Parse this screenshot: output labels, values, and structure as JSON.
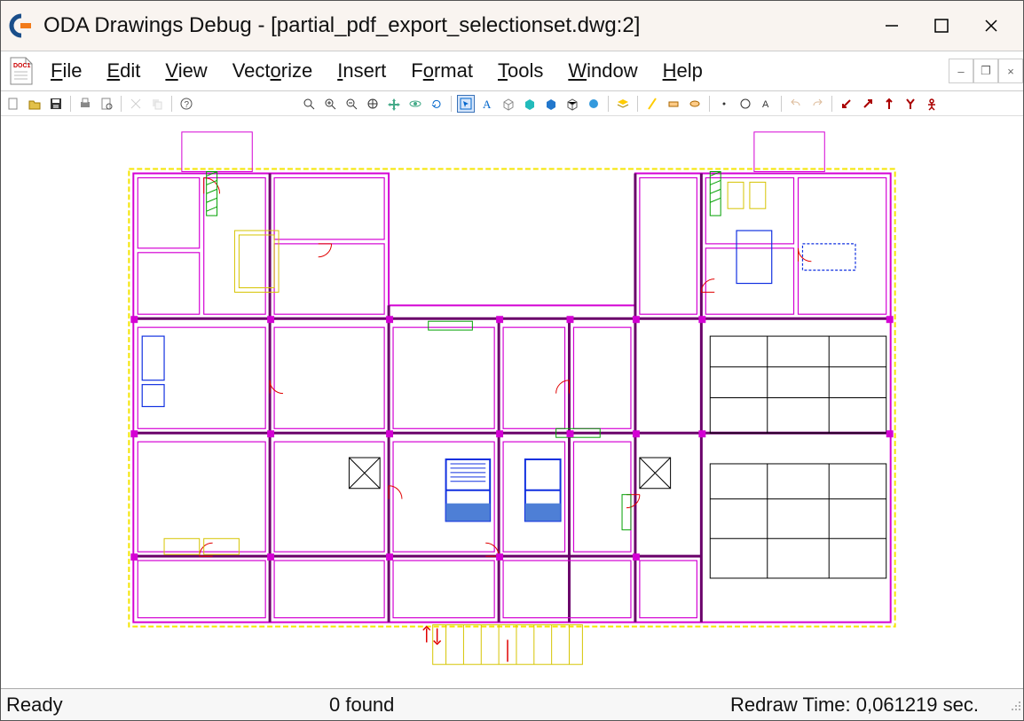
{
  "window": {
    "title": "ODA Drawings Debug - [partial_pdf_export_selectionset.dwg:2]"
  },
  "menu": {
    "items": [
      "File",
      "Edit",
      "View",
      "Vectorize",
      "Insert",
      "Format",
      "Tools",
      "Window",
      "Help"
    ]
  },
  "toolbar": {
    "group1": [
      "new",
      "open",
      "save"
    ],
    "group2": [
      "print",
      "print-preview"
    ],
    "group3": [
      "cut",
      "copy"
    ],
    "group4": [
      "help"
    ],
    "group5": [
      "zoom-extents",
      "zoom-in",
      "zoom-out",
      "zoom-window",
      "pan",
      "orbit",
      "regen"
    ],
    "group6": [
      "select",
      "text-tool",
      "box",
      "solid-cyan",
      "solid-blue",
      "wireframe",
      "render"
    ],
    "group7": [
      "layers"
    ],
    "group8": [
      "light1",
      "light2",
      "light3"
    ],
    "group9": [
      "point",
      "circle",
      "arc"
    ],
    "group10": [
      "undo",
      "redo"
    ],
    "group11": [
      "arrow-sw-red",
      "arrow-ne-red",
      "arrow-n-red",
      "fork-red",
      "person-red"
    ]
  },
  "status": {
    "left": "Ready",
    "mid": "0 found",
    "right": "Redraw Time: 0,061219 sec."
  },
  "colors": {
    "magenta": "#d400d4",
    "yellow": "#f5e500",
    "blue": "#1030e0",
    "darkred": "#8a0012",
    "red": "#e00000",
    "green": "#00a000",
    "black": "#000000"
  }
}
